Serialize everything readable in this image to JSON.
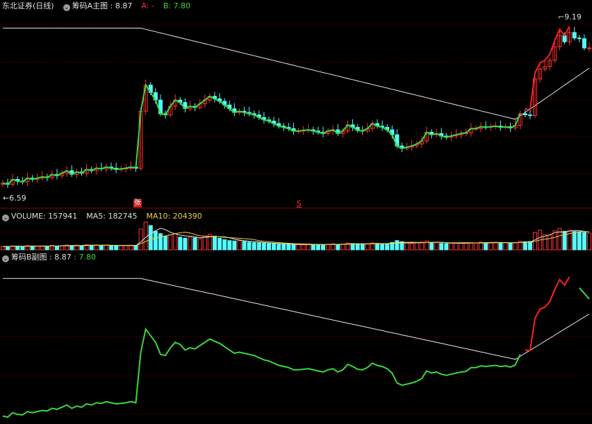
{
  "header": {
    "title": "东北证券(日线)",
    "indicator_main": "筹码A主图",
    "value_main": ": 8.87",
    "a_label": "A: -",
    "b_label": "B: 7.80"
  },
  "volume_header": {
    "volume": "VOLUME: 157941",
    "ma5": "MA5: 182745",
    "ma10": "MA10: 204390"
  },
  "sub_header": {
    "indicator": "筹码B副图",
    "value": ": 8.87",
    "b_value": ": 7.80"
  },
  "markers": {
    "zhang": "张",
    "s": "S"
  },
  "colors": {
    "up": "#ff3232",
    "down": "#54fcfc",
    "green": "#3cd83c",
    "white": "#e8e8e8",
    "red": "#ff2020",
    "yellow": "#f0d040",
    "grid": "#8b0000"
  },
  "chart_data": [
    {
      "type": "candlestick",
      "title": "筹码A主图",
      "price_labels": {
        "high": "9.19",
        "low": "6.59"
      },
      "ylim": [
        6.35,
        9.35
      ],
      "x_count": 120,
      "closes": [
        6.62,
        6.6,
        6.68,
        6.65,
        6.64,
        6.7,
        6.68,
        6.7,
        6.72,
        6.71,
        6.76,
        6.74,
        6.78,
        6.82,
        6.76,
        6.8,
        6.78,
        6.84,
        6.82,
        6.86,
        6.85,
        6.88,
        6.86,
        6.84,
        6.85,
        6.86,
        6.88,
        6.86,
        7.78,
        8.2,
        8.08,
        7.96,
        7.74,
        7.72,
        7.86,
        7.96,
        7.92,
        7.82,
        7.86,
        7.84,
        7.9,
        7.96,
        8.02,
        7.98,
        7.94,
        7.88,
        7.82,
        7.76,
        7.78,
        7.76,
        7.74,
        7.72,
        7.68,
        7.64,
        7.62,
        7.58,
        7.54,
        7.52,
        7.5,
        7.46,
        7.46,
        7.47,
        7.48,
        7.46,
        7.44,
        7.42,
        7.46,
        7.48,
        7.42,
        7.46,
        7.56,
        7.52,
        7.47,
        7.46,
        7.5,
        7.58,
        7.54,
        7.52,
        7.48,
        7.4,
        7.22,
        7.18,
        7.2,
        7.22,
        7.25,
        7.3,
        7.44,
        7.4,
        7.42,
        7.38,
        7.36,
        7.38,
        7.4,
        7.42,
        7.43,
        7.5,
        7.5,
        7.53,
        7.52,
        7.53,
        7.54,
        7.52,
        7.53,
        7.51,
        7.55,
        7.74,
        7.72,
        7.71,
        8.3,
        8.46,
        8.5,
        8.6,
        8.82,
        9.0,
        8.9,
        9.05,
        8.96,
        8.95,
        8.8,
        8.8
      ],
      "series": [
        {
          "name": "A",
          "values": []
        },
        {
          "name": "B",
          "values": []
        }
      ]
    },
    {
      "type": "bar",
      "title": "VOLUME",
      "series_info": {
        "VOLUME": 157941,
        "MA5": 182745,
        "MA10": 204390
      },
      "values": [
        28,
        30,
        34,
        32,
        30,
        36,
        32,
        30,
        34,
        30,
        40,
        33,
        36,
        42,
        38,
        40,
        36,
        44,
        40,
        42,
        38,
        40,
        36,
        34,
        36,
        38,
        40,
        38,
        180,
        240,
        210,
        160,
        140,
        120,
        130,
        140,
        110,
        100,
        108,
        104,
        95,
        120,
        135,
        118,
        100,
        88,
        80,
        76,
        78,
        72,
        66,
        62,
        60,
        58,
        55,
        52,
        50,
        48,
        46,
        44,
        45,
        44,
        50,
        48,
        44,
        43,
        46,
        52,
        48,
        50,
        58,
        54,
        50,
        48,
        52,
        60,
        56,
        54,
        52,
        64,
        80,
        70,
        58,
        54,
        60,
        68,
        76,
        64,
        62,
        56,
        54,
        56,
        58,
        60,
        58,
        62,
        60,
        66,
        62,
        64,
        66,
        60,
        62,
        58,
        64,
        74,
        70,
        72,
        150,
        170,
        130,
        128,
        164,
        186,
        160,
        170,
        158,
        156,
        150,
        144
      ]
    },
    {
      "type": "line",
      "title": "筹码B副图",
      "series": [
        {
          "name": "筹码B副图",
          "values": []
        },
        {
          "name": "B",
          "values": []
        }
      ]
    }
  ]
}
